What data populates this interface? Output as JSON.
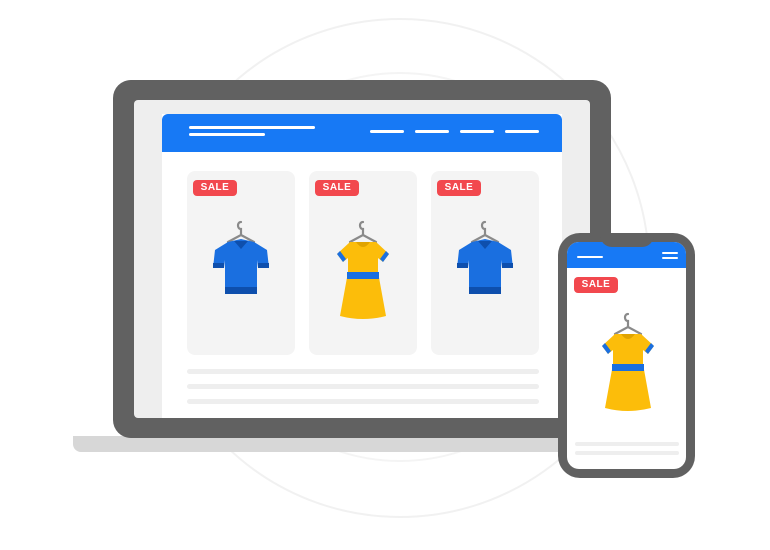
{
  "badges": {
    "card1": "SALE",
    "card2": "SALE",
    "card3": "SALE",
    "phone": "SALE"
  },
  "products": [
    {
      "kind": "shirt",
      "color": "#1a6fe0"
    },
    {
      "kind": "dress",
      "color": "#fcbd0a"
    },
    {
      "kind": "shirt",
      "color": "#1a6fe0"
    }
  ],
  "phone_product": {
    "kind": "dress",
    "color": "#fcbd0a"
  },
  "colors": {
    "brand": "#1779f5",
    "sale": "#f2484e",
    "device": "#616161",
    "shirt": "#1a6fe0",
    "dress": "#fcbd0a",
    "dress_band": "#1a6fe0"
  },
  "icons": [
    "hanger-icon",
    "shirt-icon",
    "dress-icon",
    "menu-icon"
  ]
}
